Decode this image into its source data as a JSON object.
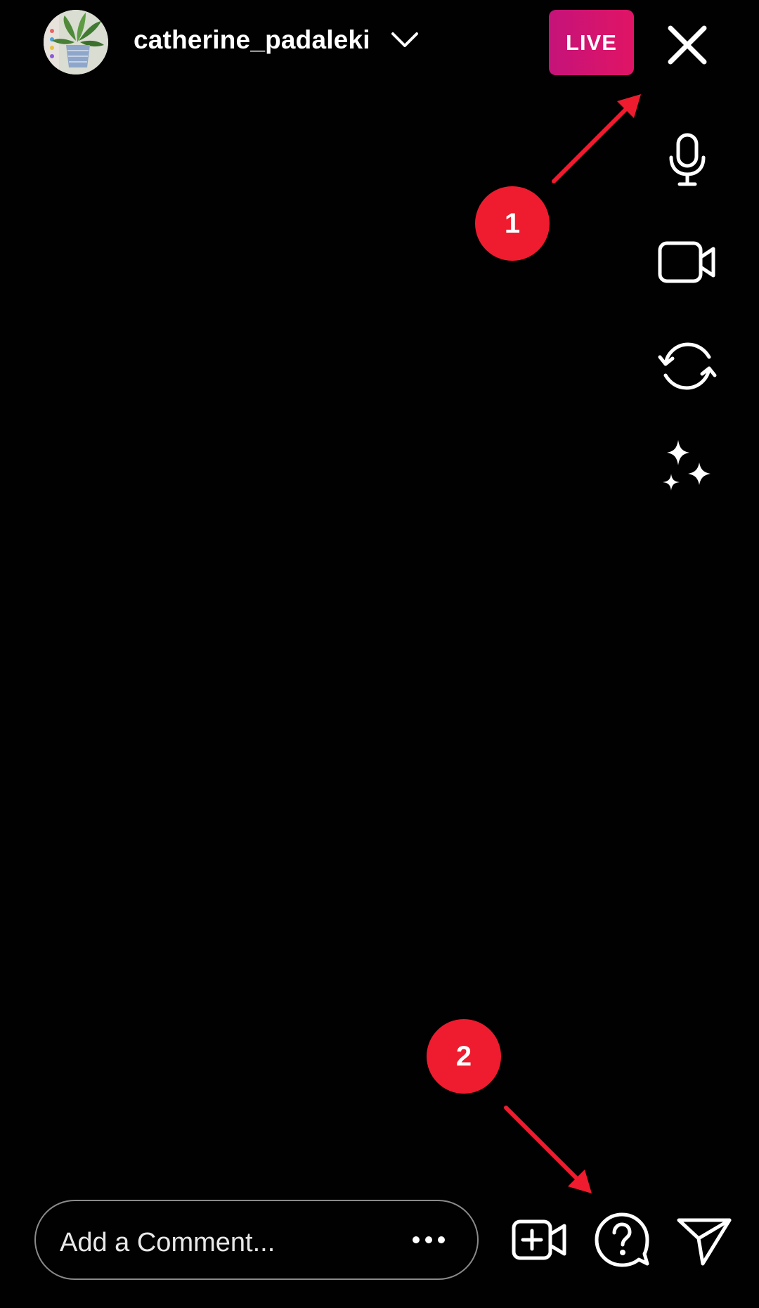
{
  "header": {
    "username": "catherine_padaleki",
    "live_label": "LIVE"
  },
  "annotations": {
    "step_1": "1",
    "step_2": "2"
  },
  "comment": {
    "placeholder": "Add a Comment..."
  },
  "icons": {
    "avatar": "profile-avatar",
    "chevron": "chevron-down-icon",
    "close": "close-icon",
    "mic": "microphone-icon",
    "video": "video-camera-icon",
    "flip": "flip-camera-icon",
    "effects": "sparkles-icon",
    "more": "more-horizontal-icon",
    "add_video": "add-guest-video-icon",
    "questions": "question-bubble-icon",
    "send": "send-icon"
  },
  "colors": {
    "background": "#000000",
    "live_badge": "#d8166f",
    "annotation": "#ee1c2e"
  }
}
